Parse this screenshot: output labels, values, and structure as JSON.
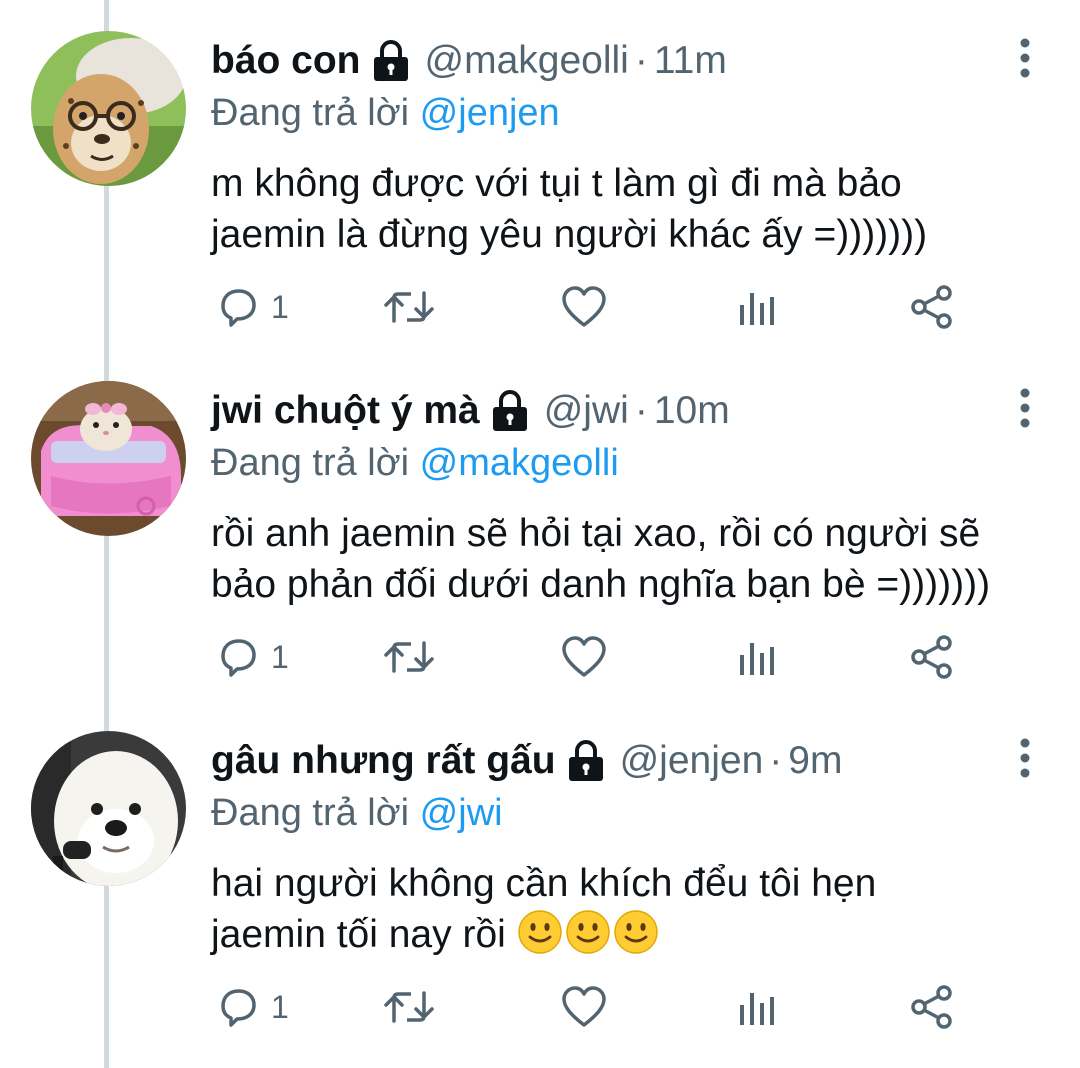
{
  "tweets": [
    {
      "name": "báo con",
      "handle": "@makgeolli",
      "separator": "·",
      "time": "11m",
      "reply_prefix": "Đang trả lời",
      "reply_to": "@jenjen",
      "text_lines": [
        "m không được với tụi t làm gì đi mà bảo",
        "jaemin là đừng yêu người khác ấy =)))))))"
      ],
      "reply_count": "1",
      "avatar": "cheetah-cub-with-glasses-avatar"
    },
    {
      "name": "jwi chuột ý mà",
      "handle": "@jwi",
      "separator": "·",
      "time": "10m",
      "reply_prefix": "Đang trả lời",
      "reply_to": "@makgeolli",
      "text_lines": [
        "rồi anh jaemin sẽ hỏi tại xao, rồi có người sẽ",
        "bảo phản đối dưới danh nghĩa bạn bè =)))))))"
      ],
      "reply_count": "1",
      "avatar": "hamster-in-pink-toy-car-avatar"
    },
    {
      "name": "gâu nhưng rất gấu",
      "handle": "@jenjen",
      "separator": "·",
      "time": "9m",
      "reply_prefix": "Đang trả lời",
      "reply_to": "@jwi",
      "text_lines": [
        "hai người không cần khích đểu tôi hẹn",
        "jaemin tối nay rồi"
      ],
      "emoji": [
        "slightly-smiling-face",
        "slightly-smiling-face",
        "slightly-smiling-face"
      ],
      "reply_count": "1",
      "avatar": "white-samoyed-dog-avatar"
    }
  ],
  "icons": {
    "lock": "lock-icon",
    "more": "more-vertical-icon",
    "reply": "reply-icon",
    "retweet": "retweet-icon",
    "like": "heart-icon",
    "analytics": "analytics-icon",
    "share": "share-icon"
  },
  "colors": {
    "mention": "#1d9bf0",
    "secondary_text": "#536471",
    "thread_line": "#cfd9de"
  }
}
